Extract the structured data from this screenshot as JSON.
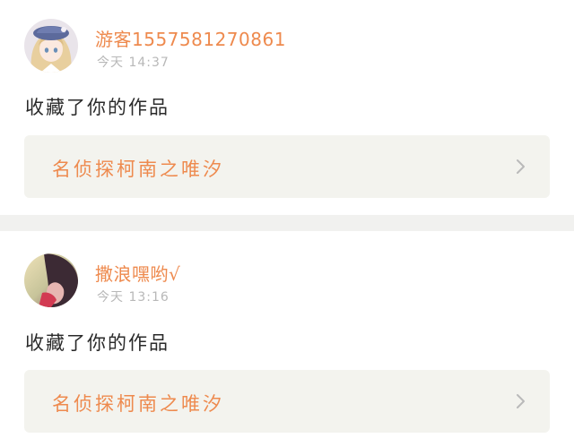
{
  "notifications": [
    {
      "username": "游客1557581270861",
      "time": "今天 14:37",
      "action": "收藏了你的作品",
      "work_title": "名侦探柯南之唯汐",
      "avatar_icon": "anime-girl-avatar",
      "chevron_icon": "chevron-right-icon"
    },
    {
      "username": "撒浪嘿哟√",
      "time": "今天 13:16",
      "action": "收藏了你的作品",
      "work_title": "名侦探柯南之唯汐",
      "avatar_icon": "photo-avatar",
      "chevron_icon": "chevron-right-icon"
    }
  ],
  "colors": {
    "accent": "#ee8a4e",
    "muted": "#b8b8b8",
    "text": "#2a2a2a",
    "panel": "#f3f3ee",
    "divider": "#f1f1ef"
  }
}
